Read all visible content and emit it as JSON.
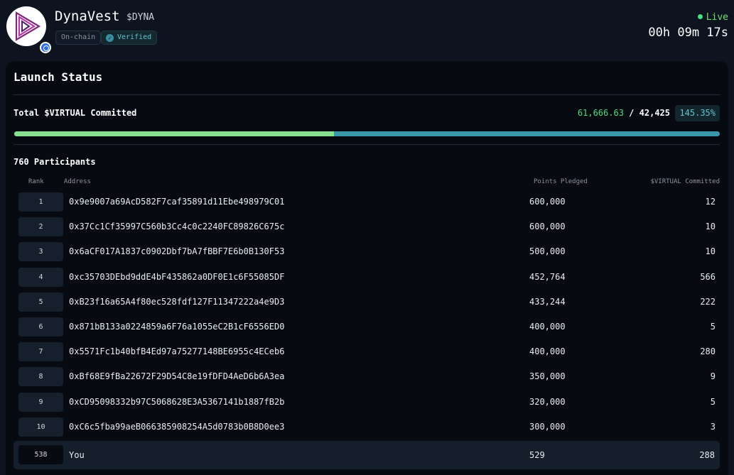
{
  "header": {
    "name": "DynaVest",
    "ticker": "$DYNA",
    "badges": {
      "onchain": "On-chain",
      "verified": "Verified"
    },
    "status": "Live",
    "timer": "00h 09m 17s",
    "colors": {
      "live": "#4ade80",
      "accent": "#5fc6d3"
    },
    "icons": {
      "logo": "play-triangle-logo-icon",
      "chain": "chain-badge-icon",
      "verified": "check-circle-icon"
    }
  },
  "launch": {
    "title": "Launch Status",
    "committed_label": "Total $VIRTUAL Committed",
    "committed_current": "61,666.63",
    "committed_sep": "/",
    "committed_target": "42,425",
    "percent_label": "145.35%",
    "progress_fraction": 0.453,
    "participants_label": "760 Participants",
    "columns": {
      "rank": "Rank",
      "address": "Address",
      "points": "Points Pledged",
      "virtual": "$VIRTUAL Committed"
    },
    "rows": [
      {
        "rank": "1",
        "address": "0x9e9007a69AcD582F7caf35891d11Ebe498979C01",
        "points": "600,000",
        "virtual": "12"
      },
      {
        "rank": "2",
        "address": "0x37Cc1Cf35997C560b3Cc4c0c2240FC89826C675c",
        "points": "600,000",
        "virtual": "10"
      },
      {
        "rank": "3",
        "address": "0x6aCF017A1837c0902Dbf7bA7fBBF7E6b0B130F53",
        "points": "500,000",
        "virtual": "10"
      },
      {
        "rank": "4",
        "address": "0xc35703DEbd9ddE4bF435862a0DF0E1c6F55085DF",
        "points": "452,764",
        "virtual": "566"
      },
      {
        "rank": "5",
        "address": "0xB23f16a65A4f80ec528fdf127F11347222a4e9D3",
        "points": "433,244",
        "virtual": "222"
      },
      {
        "rank": "6",
        "address": "0x871bB133a0224859a6F76a1055eC2B1cF6556ED0",
        "points": "400,000",
        "virtual": "5"
      },
      {
        "rank": "7",
        "address": "0x5571Fc1b40bfB4Ed97a75277148BE6955c4ECeb6",
        "points": "400,000",
        "virtual": "280"
      },
      {
        "rank": "8",
        "address": "0xBf68E9fBa22672F29D54C8e19fDFD4AeD6b6A3ea",
        "points": "350,000",
        "virtual": "9"
      },
      {
        "rank": "9",
        "address": "0xCD95098332b97C5068628E3A5367141b1887fB2b",
        "points": "320,000",
        "virtual": "5"
      },
      {
        "rank": "10",
        "address": "0xC6c5fba99aeB066385908254A5d0783b0B8D0ee3",
        "points": "300,000",
        "virtual": "3"
      }
    ],
    "you": {
      "rank": "538",
      "label": "You",
      "points": "529",
      "virtual": "288"
    }
  }
}
